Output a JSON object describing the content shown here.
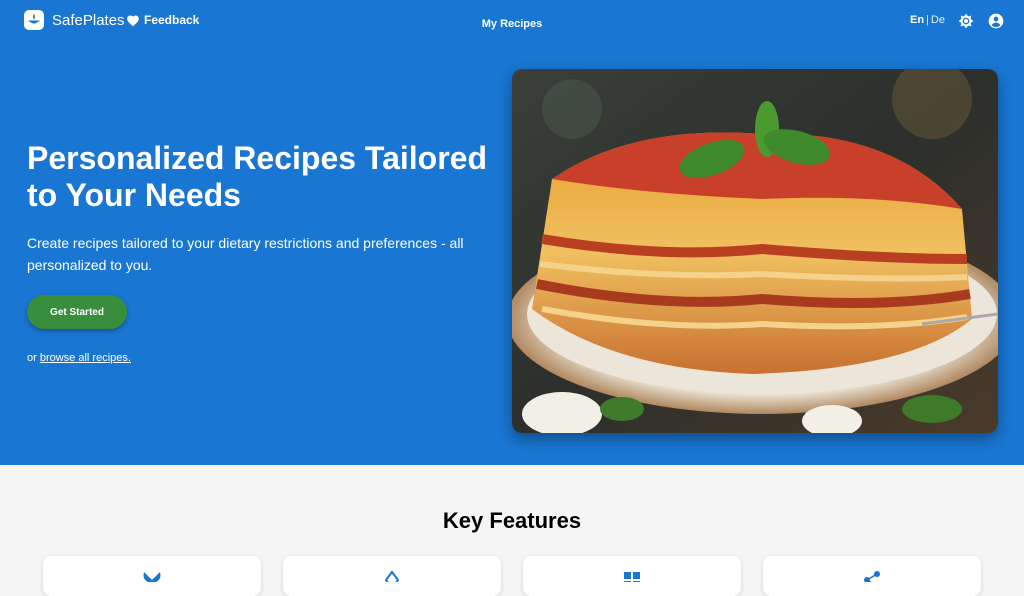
{
  "navbar": {
    "brand_name": "SafePlates",
    "feedback_label": "Feedback",
    "center_link": "My Recipes",
    "lang_active": "En",
    "lang_separator": "|",
    "lang_other": "De"
  },
  "hero": {
    "headline": "Personalized Recipes Tailored to Your Needs",
    "subtitle": "Create recipes tailored to your dietary restrictions and preferences - all personalized to you.",
    "cta_label": "Get Started",
    "browse_prefix": "or ",
    "browse_link": "browse all recipes."
  },
  "features": {
    "title": "Key Features",
    "cards": [
      {
        "icon": "butterfly-icon"
      },
      {
        "icon": "diamond-icon"
      },
      {
        "icon": "grid-icon"
      },
      {
        "icon": "share-icon"
      }
    ]
  },
  "colors": {
    "hero_bg": "#1976d2",
    "cta_bg": "#388e3c",
    "page_bg": "#f5f5f5"
  }
}
